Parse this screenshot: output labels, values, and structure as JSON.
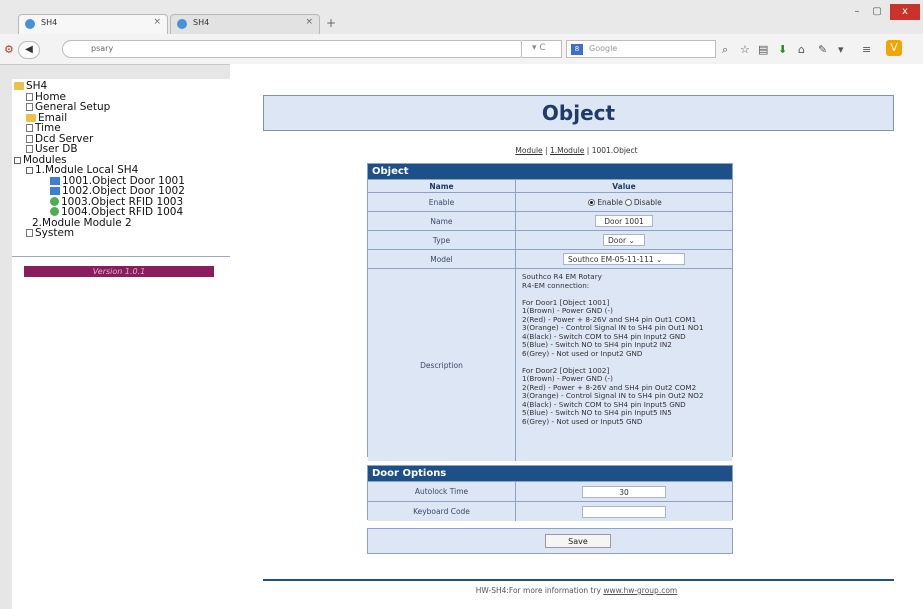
{
  "browser": {
    "tabs": [
      {
        "title": "SH4",
        "active": true
      },
      {
        "title": "SH4",
        "active": false
      }
    ],
    "new_tab": "+",
    "url": "psary",
    "search_placeholder": "Google",
    "window_controls": {
      "minimize": "–",
      "maximize": "▢",
      "close": "x"
    }
  },
  "tree": {
    "root": "SH4",
    "items": [
      {
        "label": "Home",
        "level": 1,
        "icon": "doc"
      },
      {
        "label": "General Setup",
        "level": 1,
        "icon": "doc"
      },
      {
        "label": "Email",
        "level": 1,
        "icon": "folder"
      },
      {
        "label": "Time",
        "level": 1,
        "icon": "doc"
      },
      {
        "label": "Dcd Server",
        "level": 1,
        "icon": "doc"
      },
      {
        "label": "User DB",
        "level": 1,
        "icon": "doc"
      },
      {
        "label": "Modules",
        "level": 0,
        "icon": "minus"
      },
      {
        "label": "1.Module Local SH4",
        "level": 1,
        "icon": "minus"
      },
      {
        "label": "1001.Object Door 1001",
        "level": 2,
        "icon": "doorblue"
      },
      {
        "label": "1002.Object Door 1002",
        "level": 2,
        "icon": "doorblue"
      },
      {
        "label": "1003.Object RFID 1003",
        "level": 2,
        "icon": "rfid"
      },
      {
        "label": "1004.Object RFID 1004",
        "level": 2,
        "icon": "rfid"
      },
      {
        "label": "2.Module Module 2",
        "level": 1,
        "icon": "doc"
      },
      {
        "label": "System",
        "level": 1,
        "icon": "doc"
      }
    ],
    "version": "Version 1.0.1"
  },
  "page": {
    "title": "Object",
    "breadcrumb": {
      "part1": "Module",
      "sep1": " | ",
      "part2": "1.Module",
      "sep2": " | ",
      "part3": "1001.Object"
    }
  },
  "object_section": {
    "header": "Object",
    "col_name": "Name",
    "col_value": "Value",
    "enable_label": "Enable",
    "enable_option": "Enable",
    "disable_option": "Disable",
    "name_label": "Name",
    "name_value": "Door 1001",
    "type_label": "Type",
    "type_value": "Door",
    "model_label": "Model",
    "model_value": "Southco EM-05-11-111",
    "description_label": "Description",
    "description_value": "Southco R4 EM Rotary\nR4-EM connection:\n\nFor Door1 [Object 1001]\n1(Brown) - Power GND (-)\n2(Red) - Power + 8-26V and SH4 pin Out1 COM1\n3(Orange) - Control Signal IN to SH4 pin Out1 NO1\n4(Black) - Switch COM to SH4 pin Input2 GND\n5(Blue) - Switch NO to SH4 pin Input2 IN2\n6(Grey) - Not used or Input2 GND\n\nFor Door2 [Object 1002]\n1(Brown) - Power GND (-)\n2(Red) - Power + 8-26V and SH4 pin Out2 COM2\n3(Orange) - Control Signal IN to SH4 pin Out2 NO2\n4(Black) - Switch COM to SH4 pin Input5 GND\n5(Blue) - Switch NO to SH4 pin Input5 IN5\n6(Grey) - Not used or Input5 GND"
  },
  "door_options": {
    "header": "Door Options",
    "autolock_label": "Autolock Time",
    "autolock_value": "30",
    "keyboard_label": "Keyboard Code",
    "keyboard_value": ""
  },
  "save_label": "Save",
  "footer": {
    "text": "HW-SH4:For more information try ",
    "link": "www.hw-group.com"
  },
  "colors": {
    "header_blue": "#1d5088",
    "row_bg": "#dde6f5",
    "version_bar": "#8b1c5e"
  }
}
